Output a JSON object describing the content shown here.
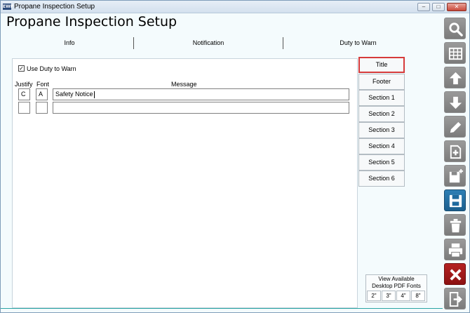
{
  "window": {
    "title": "Propane Inspection Setup",
    "app_icon_text": "EWP"
  },
  "page": {
    "title": "Propane Inspection Setup"
  },
  "tabs": [
    {
      "label": "Info"
    },
    {
      "label": "Notification"
    },
    {
      "label": "Duty to Warn"
    }
  ],
  "form": {
    "use_duty_to_warn": {
      "label": "Use Duty to Warn",
      "checked": true
    },
    "headers": {
      "justify": "Justify",
      "font": "Font",
      "message": "Message"
    },
    "rows": [
      {
        "justify": "C",
        "font": "A",
        "message": "Safety Notice"
      },
      {
        "justify": "",
        "font": "",
        "message": ""
      }
    ]
  },
  "sections": [
    "Title",
    "Footer",
    "Section 1",
    "Section 2",
    "Section 3",
    "Section 4",
    "Section 5",
    "Section 6"
  ],
  "pdf_fonts": {
    "label_line1": "View Available",
    "label_line2": "Desktop PDF Fonts",
    "sizes": [
      "2\"",
      "3\"",
      "4\"",
      "8\""
    ]
  },
  "toolbar": [
    "search-icon",
    "grid-icon",
    "arrow-up-icon",
    "arrow-down-icon",
    "pencil-icon",
    "new-document-icon",
    "save-new-icon",
    "save-icon",
    "trash-icon",
    "print-icon",
    "close-icon",
    "exit-icon"
  ],
  "colors": {
    "highlight": "#d63b3b",
    "active_save": "#1f6a9e",
    "cancel": "#9b1a1a"
  }
}
